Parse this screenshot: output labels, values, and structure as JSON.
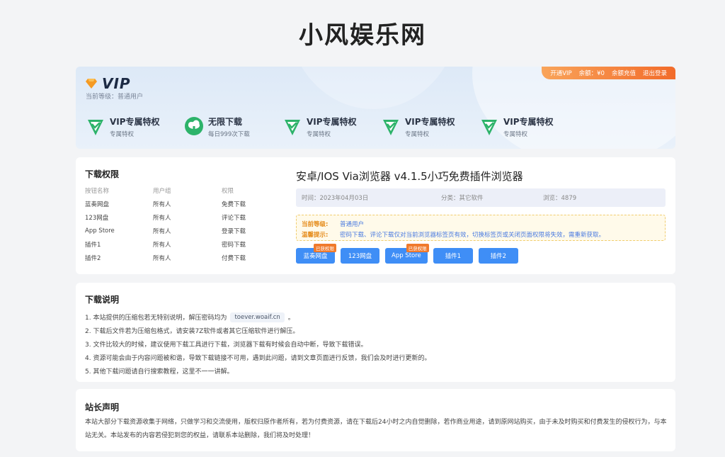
{
  "site": {
    "title": "小风娱乐网"
  },
  "vip": {
    "logo_text": "VIP",
    "level_line": "当前等级：普通用户",
    "topbar": {
      "open_vip": "开通VIP",
      "balance": "余额：¥0",
      "recharge": "余额充值",
      "logout": "退出登录"
    },
    "perks": [
      {
        "title": "VIP专属特权",
        "sub": "专属特权",
        "icon": "vip-badge-icon"
      },
      {
        "title": "无限下载",
        "sub": "每日999次下载",
        "icon": "cloud-download-icon"
      },
      {
        "title": "VIP专属特权",
        "sub": "专属特权",
        "icon": "vip-badge-icon"
      },
      {
        "title": "VIP专属特权",
        "sub": "专属特权",
        "icon": "vip-badge-icon"
      },
      {
        "title": "VIP专属特权",
        "sub": "专属特权",
        "icon": "vip-badge-icon"
      }
    ],
    "colors": {
      "orange": "#f26b2a",
      "green": "#2db36a",
      "blue_bg": "#dde9f7"
    }
  },
  "permissions": {
    "title": "下载权限",
    "headers": [
      "按钮名称",
      "用户组",
      "权限"
    ],
    "rows": [
      [
        "蓝奏网盘",
        "所有人",
        "免费下载"
      ],
      [
        "123网盘",
        "所有人",
        "评论下载"
      ],
      [
        "App Store",
        "所有人",
        "登录下载"
      ],
      [
        "插件1",
        "所有人",
        "密码下载"
      ],
      [
        "插件2",
        "所有人",
        "付费下载"
      ]
    ]
  },
  "post": {
    "title": "安卓/IOS Via浏览器 v4.1.5小巧免费插件浏览器",
    "meta": {
      "time": "时间：2023年04月03日",
      "category": "分类：其它软件",
      "views": "浏览：4879"
    },
    "notice": {
      "level_label": "当前等级:",
      "level_value": "普通用户",
      "tip_label": "温馨提示:",
      "tip_value": "密码下载、评论下载仅对当前浏览器标签页有效，切换标签页或关闭页面权限将失效，需重新获取。"
    },
    "buttons": [
      {
        "label": "蓝奏网盘",
        "tag": "已获权限"
      },
      {
        "label": "123网盘",
        "tag": ""
      },
      {
        "label": "App Store",
        "tag": "已获权限"
      },
      {
        "label": "插件1",
        "tag": ""
      },
      {
        "label": "插件2",
        "tag": ""
      }
    ],
    "accent": "#3f8ef6"
  },
  "instructions": {
    "title": "下载说明",
    "item1_pre": "1. 本站提供的压缩包若无特别说明，解压密码均为",
    "item1_code": "toever.woaif.cn",
    "item1_post": "。",
    "item2": "2. 下载后文件若为压缩包格式，请安装7Z软件或者其它压缩软件进行解压。",
    "item3": "3. 文件比较大的时候，建议使用下载工具进行下载，浏览器下载有时候会自动中断，导致下载错误。",
    "item4": "4. 资源可能会由于内容问题被和谐，导致下载链接不可用，遇到此问题，请到文章页面进行反馈，我们会及时进行更新的。",
    "item5": "5. 其他下载问题请自行搜索教程，这里不一一讲解。"
  },
  "statement": {
    "title": "站长声明",
    "body": "本站大部分下载资源收集于网络，只做学习和交流使用，版权归原作者所有，若为付费资源，请在下载后24小时之内自觉删除，若作商业用途，请到原网站购买，由于未及时购买和付费发生的侵权行为，与本站无关。本站发布的内容若侵犯到您的权益，请联系本站删除，我们将及时处理！"
  }
}
